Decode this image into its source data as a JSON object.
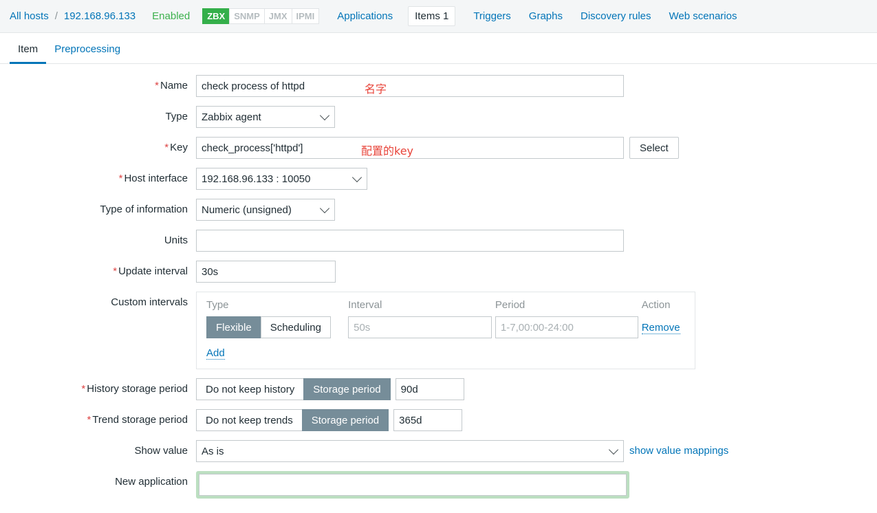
{
  "header": {
    "breadcrumb": {
      "all_hosts": "All hosts",
      "separator": "/",
      "host": "192.168.96.133"
    },
    "status": "Enabled",
    "protocols": [
      {
        "label": "ZBX",
        "active": true
      },
      {
        "label": "SNMP",
        "active": false
      },
      {
        "label": "JMX",
        "active": false
      },
      {
        "label": "IPMI",
        "active": false
      }
    ],
    "nav": [
      {
        "label": "Applications",
        "selected": false
      },
      {
        "label": "Items 1",
        "selected": true
      },
      {
        "label": "Triggers",
        "selected": false
      },
      {
        "label": "Graphs",
        "selected": false
      },
      {
        "label": "Discovery rules",
        "selected": false
      },
      {
        "label": "Web scenarios",
        "selected": false
      }
    ],
    "colors": {
      "link": "#0275b8",
      "enabled": "#3db14d",
      "zbx_badge": "#34af4a"
    }
  },
  "tabs": [
    {
      "label": "Item",
      "active": true
    },
    {
      "label": "Preprocessing",
      "active": false
    }
  ],
  "form": {
    "name": {
      "label": "Name",
      "required": true,
      "value": "check process of httpd"
    },
    "type": {
      "label": "Type",
      "required": false,
      "value": "Zabbix agent"
    },
    "key": {
      "label": "Key",
      "required": true,
      "value": "check_process['httpd']",
      "button": "Select"
    },
    "host_interface": {
      "label": "Host interface",
      "required": true,
      "value": "192.168.96.133 : 10050"
    },
    "type_of_information": {
      "label": "Type of information",
      "required": false,
      "value": "Numeric (unsigned)"
    },
    "units": {
      "label": "Units",
      "required": false,
      "value": ""
    },
    "update_interval": {
      "label": "Update interval",
      "required": true,
      "value": "30s"
    },
    "custom_intervals": {
      "label": "Custom intervals",
      "headers": {
        "type": "Type",
        "interval": "Interval",
        "period": "Period",
        "action": "Action"
      },
      "row": {
        "type_flexible": "Flexible",
        "type_scheduling": "Scheduling",
        "selected_type": "Flexible",
        "interval_value": "",
        "interval_placeholder": "50s",
        "period_value": "",
        "period_placeholder": "1-7,00:00-24:00",
        "action": "Remove"
      },
      "add_label": "Add"
    },
    "history_storage": {
      "label": "History storage period",
      "required": true,
      "option_off": "Do not keep history",
      "option_on": "Storage period",
      "selected": "Storage period",
      "value": "90d"
    },
    "trend_storage": {
      "label": "Trend storage period",
      "required": true,
      "option_off": "Do not keep trends",
      "option_on": "Storage period",
      "selected": "Storage period",
      "value": "365d"
    },
    "show_value": {
      "label": "Show value",
      "required": false,
      "value": "As is",
      "link": "show value mappings"
    },
    "new_application": {
      "label": "New application",
      "required": false,
      "value": "",
      "focused": true,
      "focus_color": "#bcdfc1"
    }
  },
  "annotations": [
    {
      "text": "名字",
      "color": "#e8443a"
    },
    {
      "text": "配置的key",
      "color": "#e8443a"
    }
  ]
}
